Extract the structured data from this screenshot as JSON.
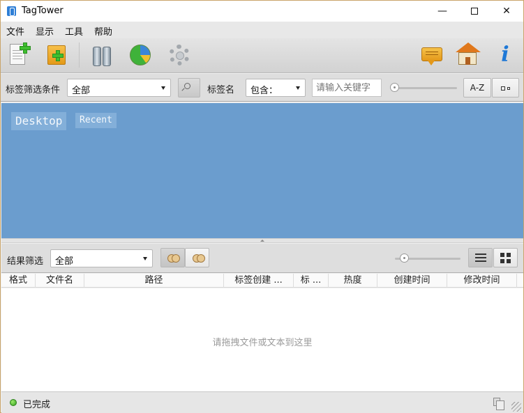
{
  "window": {
    "title": "TagTower",
    "minimize": "—",
    "close": "✕"
  },
  "menu": {
    "items": [
      "文件",
      "显示",
      "工具",
      "帮助"
    ]
  },
  "toolbar": {
    "left_icons": [
      "new-document-icon",
      "new-folder-icon",
      "binoculars-icon",
      "pie-chart-icon",
      "settings-gear-icon"
    ],
    "right_icons": [
      "speech-bubble-icon",
      "home-icon",
      "info-icon"
    ],
    "info_glyph": "i"
  },
  "filter": {
    "condition_label": "标签筛选条件",
    "condition_value": "全部",
    "tag_name_label": "标签名",
    "match_value": "包含：",
    "keyword_placeholder": "请输入关键字",
    "sort_label": "A-Z"
  },
  "tags": {
    "items": [
      "Desktop",
      "Recent"
    ]
  },
  "results": {
    "filter_label": "结果筛选",
    "filter_value": "全部"
  },
  "table": {
    "columns": [
      "格式",
      "文件名",
      "路径",
      "标签创建 ...",
      "标 ...",
      "热度",
      "创建时间",
      "修改时间"
    ],
    "empty_hint": "请拖拽文件或文本到这里"
  },
  "status": {
    "text": "已完成"
  },
  "colors": {
    "tag_area": "#6b9dce",
    "tag_chip": "#83afd9",
    "status_ok": "#35a021"
  }
}
